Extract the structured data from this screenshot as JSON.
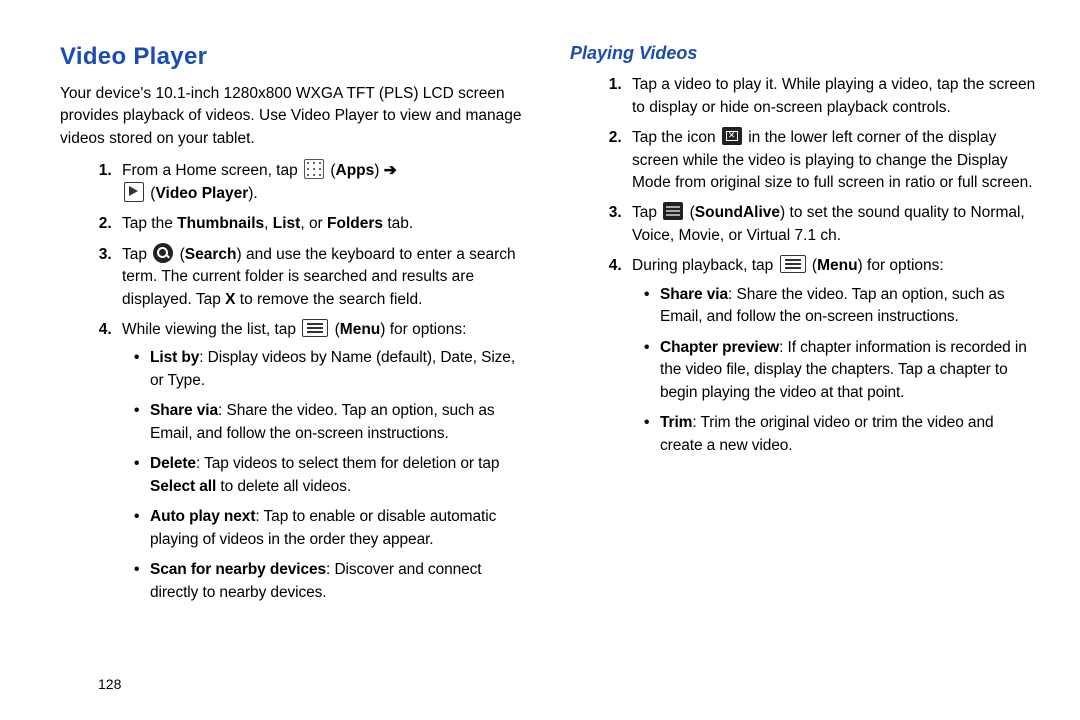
{
  "page_number": "128",
  "left": {
    "title": "Video Player",
    "intro": "Your device's 10.1-inch 1280x800 WXGA TFT (PLS) LCD screen provides playback of videos. Use Video Player to view and manage videos stored on your tablet.",
    "steps": {
      "s1_a": "From a Home screen, tap ",
      "apps_label": "Apps",
      "arrow": "➔",
      "vp_label": "Video Player",
      "s2_a": "Tap the ",
      "s2_b": "Thumbnails",
      "s2_c": ", ",
      "s2_d": "List",
      "s2_e": ", or ",
      "s2_f": "Folders",
      "s2_g": " tab.",
      "s3_a": "Tap ",
      "s3_b": "Search",
      "s3_c": ") and use the keyboard to enter a search term. The current folder is searched and results are displayed. Tap ",
      "s3_x": "X",
      "s3_d": " to remove the search field.",
      "s4_a": "While viewing the list, tap ",
      "s4_b": "Menu",
      "s4_c": ") for options:"
    },
    "bullets": {
      "b1_a": "List by",
      "b1_b": ": Display videos by Name (default), Date, Size, or Type.",
      "b2_a": "Share via",
      "b2_b": ": Share the video. Tap an option, such as Email, and follow the on-screen instructions.",
      "b3_a": "Delete",
      "b3_b": ": Tap videos to select them for deletion or tap ",
      "b3_c": "Select all",
      "b3_d": " to delete all videos.",
      "b4_a": "Auto play next",
      "b4_b": ": Tap to enable or disable automatic playing of videos in the order they appear.",
      "b5_a": "Scan for nearby devices",
      "b5_b": ": Discover and connect directly to nearby devices."
    }
  },
  "right": {
    "title": "Playing Videos",
    "steps": {
      "r1": "Tap a video to play it. While playing a video, tap the screen to display or hide on-screen playback controls.",
      "r2_a": "Tap the icon ",
      "r2_b": " in the lower left corner of the display screen while the video is playing to change the Display Mode from original size to full screen in ratio or full screen.",
      "r3_a": "Tap ",
      "r3_b": "SoundAlive",
      "r3_c": ") to set the sound quality to Normal, Voice, Movie, or Virtual 7.1 ch.",
      "r4_a": "During playback, tap ",
      "r4_b": "Menu",
      "r4_c": ") for options:"
    },
    "bullets": {
      "rb1_a": "Share via",
      "rb1_b": ": Share the video. Tap an option, such as Email, and follow the on-screen instructions.",
      "rb2_a": "Chapter preview",
      "rb2_b": ": If chapter information is recorded in the video file, display the chapters. Tap a chapter to begin playing the video at that point.",
      "rb3_a": "Trim",
      "rb3_b": ": Trim the original video or trim the video and create a new video."
    }
  }
}
